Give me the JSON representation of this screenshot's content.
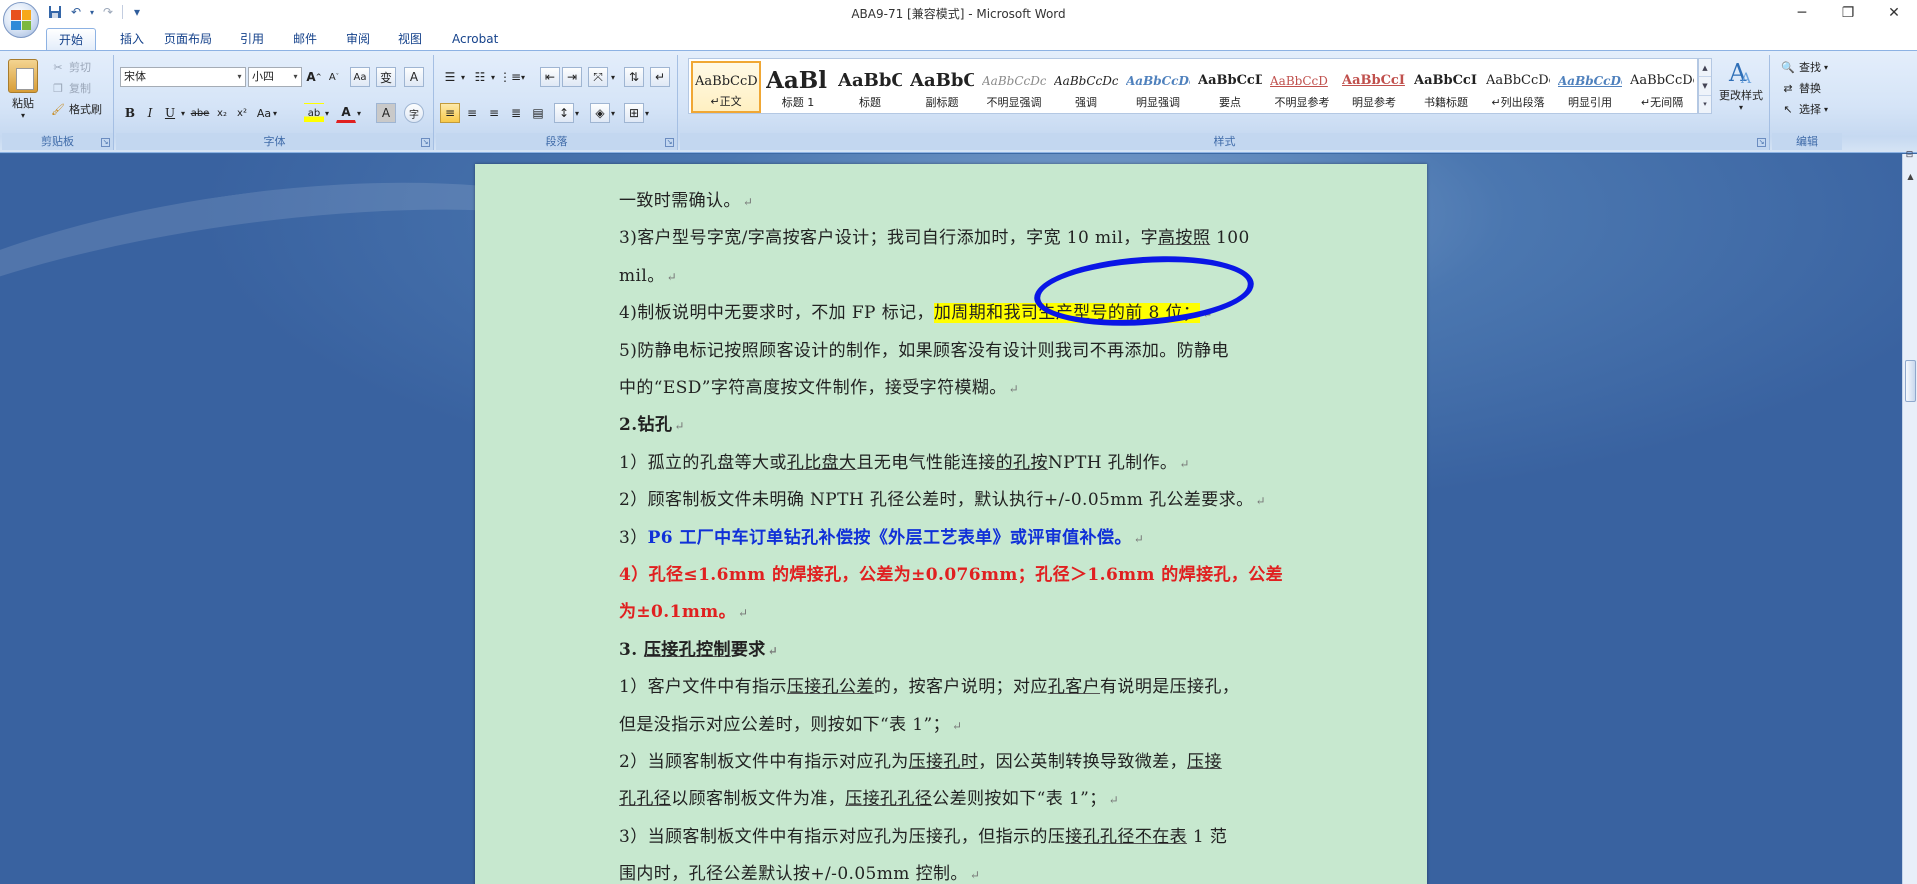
{
  "app": {
    "title": "ABA9-71 [兼容模式] - Microsoft Word"
  },
  "window_controls": {
    "minimize": "─",
    "maximize": "❐",
    "close": "✕"
  },
  "qat": {
    "save": "💾",
    "undo": "↶",
    "redo": "↷",
    "customize": "▾"
  },
  "tabs": [
    "开始",
    "插入",
    "页面布局",
    "引用",
    "邮件",
    "审阅",
    "视图",
    "Acrobat"
  ],
  "ribbon": {
    "clipboard": {
      "label": "剪贴板",
      "paste": "粘贴",
      "cut": "剪切",
      "copy": "复制",
      "format_painter": "格式刷"
    },
    "font": {
      "label": "字体",
      "font_name": "宋体",
      "font_size": "小四",
      "grow": "A",
      "shrink": "A",
      "clear": "Aa",
      "phonetic": "变",
      "border": "A",
      "bold": "B",
      "italic": "I",
      "underline": "U",
      "strike": "abe",
      "subscript": "x₂",
      "superscript": "x²",
      "case": "Aa",
      "highlight": "ab",
      "font_color": "A",
      "shade": "A",
      "enclose": "字"
    },
    "paragraph": {
      "label": "段落"
    },
    "styles": {
      "label": "样式",
      "change_styles": "更改样式",
      "items": [
        {
          "sample": "AaBbCcDc",
          "name": "↵正文",
          "active": true
        },
        {
          "sample": "AaBl",
          "name": "标题 1"
        },
        {
          "sample": "AaBbC",
          "name": "标题"
        },
        {
          "sample": "AaBbC",
          "name": "副标题"
        },
        {
          "sample": "AaBbCcDc",
          "name": "不明显强调"
        },
        {
          "sample": "AaBbCcDc",
          "name": "强调"
        },
        {
          "sample": "AaBbCcDc",
          "name": "明显强调"
        },
        {
          "sample": "AaBbCcD",
          "name": "要点"
        },
        {
          "sample": "AaBbCcD",
          "name": "不明显参考"
        },
        {
          "sample": "AaBbCcI",
          "name": "明显参考"
        },
        {
          "sample": "AaBbCcI",
          "name": "书籍标题"
        },
        {
          "sample": "AaBbCcDc",
          "name": "↵列出段落"
        },
        {
          "sample": "AaBbCcDc",
          "name": "明显引用"
        },
        {
          "sample": "AaBbCcDc",
          "name": "↵无间隔"
        }
      ]
    },
    "editing": {
      "label": "编辑",
      "find": "查找",
      "replace": "替换",
      "select": "选择"
    }
  },
  "document": {
    "paragraph_mark": "↵",
    "lines": [
      {
        "parts": [
          {
            "t": "一致时需确认。"
          }
        ]
      },
      {
        "parts": [
          {
            "t": "3)客户型号字宽/字高按客户设计；我司自行添加时，字宽 10 mil，字"
          },
          {
            "t": "高按照",
            "s": "ul"
          },
          {
            "t": " 100"
          }
        ],
        "nomark": true
      },
      {
        "parts": [
          {
            "t": "mil。"
          }
        ]
      },
      {
        "parts": [
          {
            "t": "4)制板说明中无要求时，不加 FP 标记，"
          },
          {
            "t": "加周期和我司生产型号的前 8 位；",
            "s": "hl"
          }
        ]
      },
      {
        "parts": [
          {
            "t": "5)防静电标记按照顾客设计的制作，如果顾客没有设计则我司不再添加。防静电"
          }
        ],
        "nomark": true
      },
      {
        "parts": [
          {
            "t": "中的“ESD”字符高度按文件制作，接受字符模糊。"
          }
        ]
      },
      {
        "parts": [
          {
            "t": "2.钻孔",
            "s": "bold"
          }
        ]
      },
      {
        "parts": [
          {
            "t": "1）孤立的孔盘等大或"
          },
          {
            "t": "孔比盘大",
            "s": "ul"
          },
          {
            "t": "且无电气性能连接"
          },
          {
            "t": "的孔按",
            "s": "ul"
          },
          {
            "t": "NPTH 孔制作。"
          }
        ]
      },
      {
        "parts": [
          {
            "t": "2）顾客制板文件未明确 NPTH 孔径公差时，默认执行+/-0.05mm 孔公差要求。"
          }
        ]
      },
      {
        "parts": [
          {
            "t": "3）"
          },
          {
            "t": "P6 工厂中车订单钻孔补偿按《外层工艺表单》或评审值补偿。",
            "s": "blue"
          }
        ]
      },
      {
        "parts": [
          {
            "t": "4）孔径≤1.6mm 的焊接孔，公差为±0.076mm；孔径＞1.6mm 的焊接孔，公差",
            "s": "red"
          }
        ],
        "nomark": true
      },
      {
        "parts": [
          {
            "t": "为±0.1mm。",
            "s": "red"
          }
        ]
      },
      {
        "parts": [
          {
            "t": "3. "
          },
          {
            "t": "压接孔控制",
            "s": "ul"
          },
          {
            "t": "要求"
          }
        ],
        "bold": true
      },
      {
        "parts": [
          {
            "t": "1）客户文件中有指示"
          },
          {
            "t": "压接孔公差",
            "s": "ul"
          },
          {
            "t": "的，按客户说明；对应"
          },
          {
            "t": "孔客户",
            "s": "ul"
          },
          {
            "t": "有说明是压接孔，"
          }
        ],
        "nomark": true
      },
      {
        "parts": [
          {
            "t": "但是没指示对应公差时，则按如下“表 1”；"
          }
        ]
      },
      {
        "parts": [
          {
            "t": "2）当顾客制板文件中有指示对应孔为"
          },
          {
            "t": "压接孔时",
            "s": "ul"
          },
          {
            "t": "，因公英制转换导致微差，"
          },
          {
            "t": "压接",
            "s": "ul"
          }
        ],
        "nomark": true
      },
      {
        "parts": [
          {
            "t": "孔孔径",
            "s": "ul"
          },
          {
            "t": "以顾客制板文件为准，"
          },
          {
            "t": "压接孔孔径",
            "s": "ul"
          },
          {
            "t": "公差则按如下“表 1”；"
          }
        ]
      },
      {
        "parts": [
          {
            "t": "3）当顾客制板文件中有指示对应孔为压接孔，但指示的压"
          },
          {
            "t": "接孔孔径不在表",
            "s": "ul"
          },
          {
            "t": " 1 范"
          }
        ],
        "nomark": true
      },
      {
        "parts": [
          {
            "t": "围内时，孔径公差默认按+/-0.05mm 控制。"
          }
        ]
      }
    ]
  },
  "colors": {
    "page_bg": "#c7e8cf",
    "highlight": "#ffff00",
    "blue_text": "#1030d8",
    "red_text": "#e02020",
    "annotation": "#0a16e6"
  }
}
